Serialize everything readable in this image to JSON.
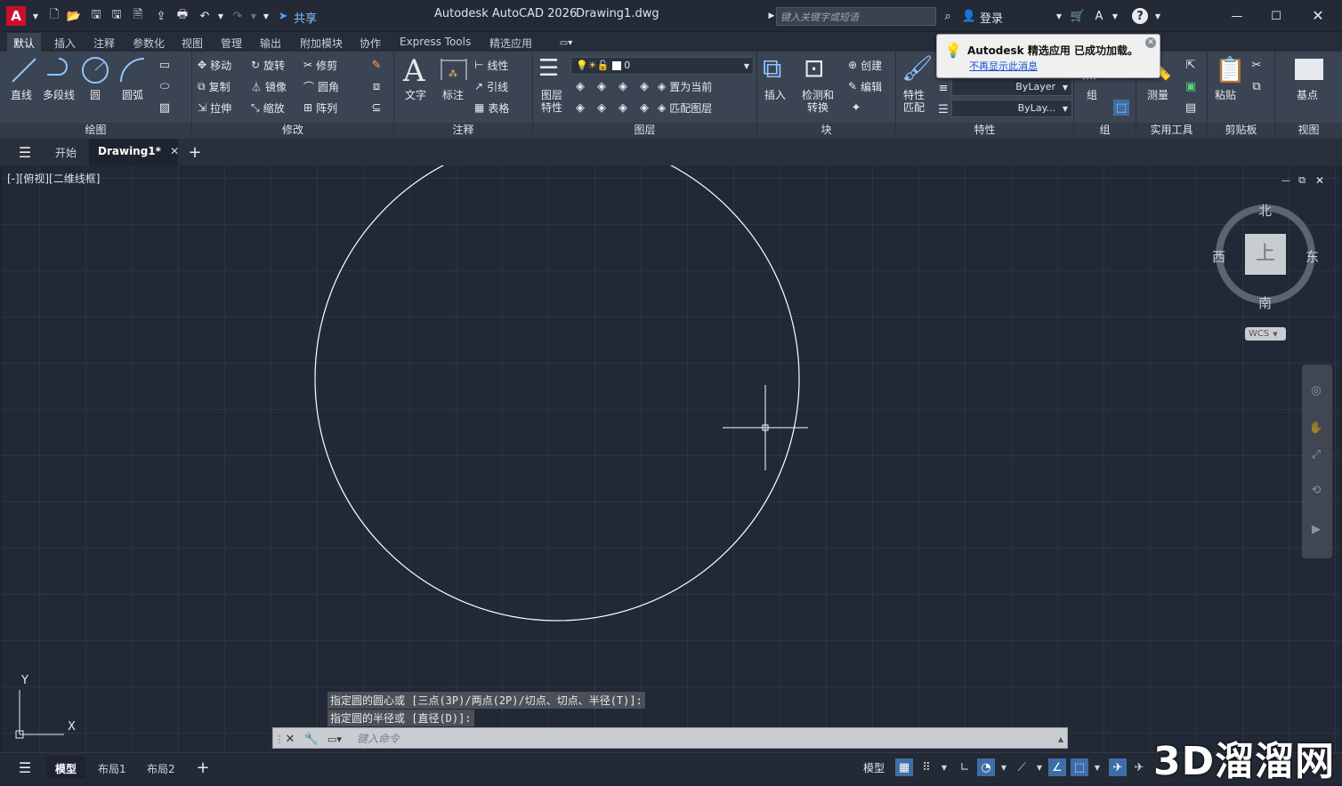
{
  "titlebar": {
    "app_title": "Autodesk AutoCAD 2026",
    "doc_title": "Drawing1.dwg",
    "share_label": "共享",
    "search_placeholder": "键入关键字或短语",
    "login_label": "登录"
  },
  "ribbon_tabs": [
    "默认",
    "插入",
    "注释",
    "参数化",
    "视图",
    "管理",
    "输出",
    "附加模块",
    "协作",
    "Express Tools",
    "精选应用"
  ],
  "ribbon": {
    "draw": {
      "title": "绘图",
      "line": "直线",
      "polyline": "多段线",
      "circle": "圆",
      "arc": "圆弧"
    },
    "modify": {
      "title": "修改",
      "move": "移动",
      "rotate": "旋转",
      "trim": "修剪",
      "copy": "复制",
      "mirror": "镜像",
      "fillet": "圆角",
      "stretch": "拉伸",
      "scale": "缩放",
      "array": "阵列"
    },
    "annotation": {
      "title": "注释",
      "text": "文字",
      "dimension": "标注",
      "linear": "线性",
      "leader": "引线",
      "table": "表格"
    },
    "layers": {
      "title": "图层",
      "layer_props": "图层\n特性",
      "layer_value": "0",
      "set_current": "置为当前",
      "match_layer": "匹配图层"
    },
    "block": {
      "title": "块",
      "insert": "插入",
      "detect": "检测和\n转换",
      "create": "创建",
      "edit": "编辑"
    },
    "properties": {
      "title": "特性",
      "match": "特性\n匹配",
      "linetype": "ByLayer",
      "lineweight": "ByLay..."
    },
    "groups": {
      "title": "组",
      "group": "组"
    },
    "utilities": {
      "title": "实用工具",
      "measure": "测量"
    },
    "clipboard": {
      "title": "剪贴板",
      "paste": "粘贴"
    },
    "view": {
      "title": "视图",
      "base": "基点"
    }
  },
  "notification": {
    "title": "Autodesk 精选应用 已成功加载。",
    "link": "不再显示此消息"
  },
  "file_tabs": {
    "start": "开始",
    "drawing": "Drawing1*"
  },
  "viewport": {
    "label": "[-][俯视][二维线框]",
    "viewcube": {
      "north": "北",
      "south": "南",
      "east": "东",
      "west": "西",
      "face": "上",
      "wcs": "WCS"
    },
    "ucs": {
      "x": "X",
      "y": "Y"
    }
  },
  "command": {
    "history": [
      "指定圆的圆心或 [三点(3P)/两点(2P)/切点、切点、半径(T)]:",
      "指定圆的半径或 [直径(D)]:"
    ],
    "placeholder": "键入命令"
  },
  "status": {
    "layout_tabs": [
      "模型",
      "布局1",
      "布局2"
    ],
    "model_label": "模型"
  },
  "watermark": "3D溜溜网"
}
